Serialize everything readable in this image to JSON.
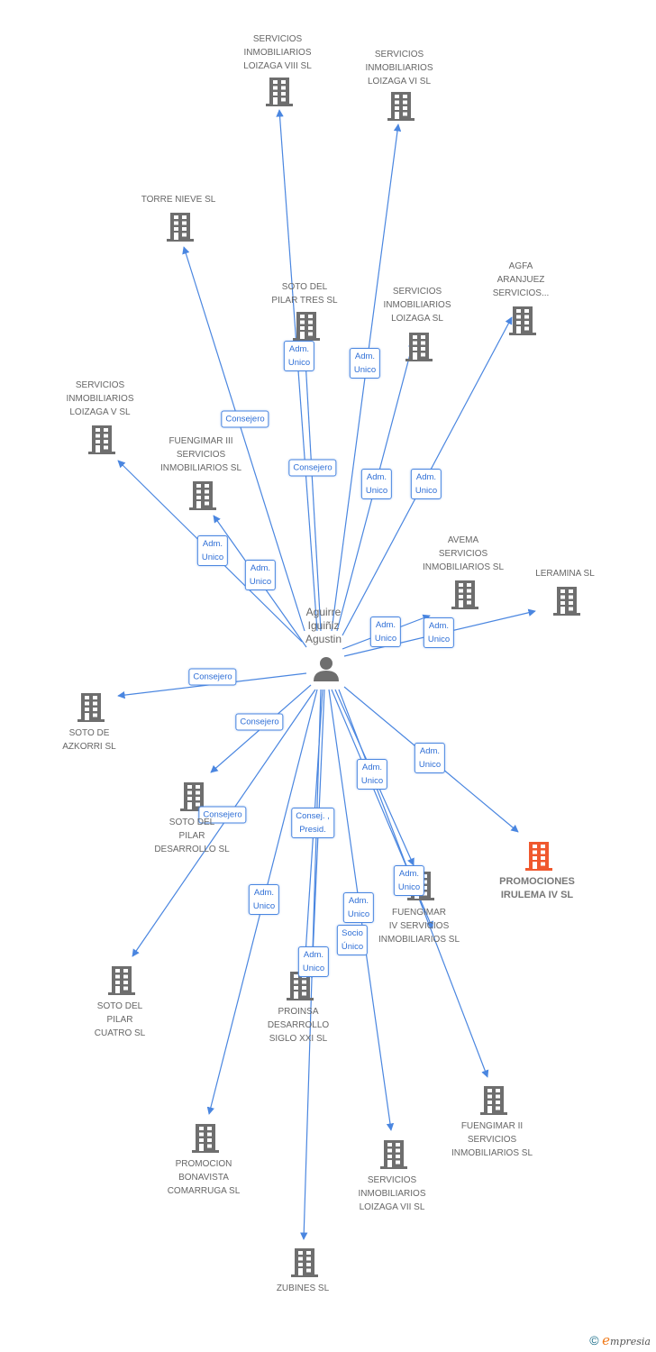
{
  "colors": {
    "edge": "#4a86e0",
    "node": "#6e6e6e",
    "highlight": "#f0582e",
    "text": "#666666"
  },
  "center": {
    "name": "Aguirre\nIguiñiz\nAgustin",
    "icon": "person-icon"
  },
  "nodes": [
    {
      "name": "SERVICIOS\nINMOBILIARIOS\nLOIZAGA VIII SL"
    },
    {
      "name": "SERVICIOS\nINMOBILIARIOS\nLOIZAGA VI SL"
    },
    {
      "name": "TORRE NIEVE SL"
    },
    {
      "name": "SOTO DEL\nPILAR TRES SL"
    },
    {
      "name": "SERVICIOS\nINMOBILIARIOS\nLOIZAGA SL"
    },
    {
      "name": "AGFA\nARANJUEZ\nSERVICIOS..."
    },
    {
      "name": "SERVICIOS\nINMOBILIARIOS\nLOIZAGA V SL"
    },
    {
      "name": "FUENGIMAR III\nSERVICIOS\nINMOBILIARIOS SL"
    },
    {
      "name": "AVEMA\nSERVICIOS\nINMOBILIARIOS SL"
    },
    {
      "name": "LERAMINA SL"
    },
    {
      "name": "SOTO DE\nAZKORRI SL"
    },
    {
      "name": "SOTO DEL\nPILAR\nDESARROLLO SL"
    },
    {
      "name": "PROMOCIONES\nIRULEMA IV SL",
      "highlight": true
    },
    {
      "name": "FUENGIMAR\nIV SERVICIOS\nINMOBILIARIOS SL"
    },
    {
      "name": "SOTO DEL\nPILAR\nCUATRO SL"
    },
    {
      "name": "PROINSA\nDESARROLLO\nSIGLO XXI SL"
    },
    {
      "name": "FUENGIMAR II\nSERVICIOS\nINMOBILIARIOS SL"
    },
    {
      "name": "PROMOCION\nBONAVISTA\nCOMARRUGA SL"
    },
    {
      "name": "SERVICIOS\nINMOBILIARIOS\nLOIZAGA VII SL"
    },
    {
      "name": "ZUBINES SL"
    }
  ],
  "edges": [
    {
      "to": 0,
      "label": "Adm.\nUnico"
    },
    {
      "to": 1,
      "label": "Adm.\nUnico"
    },
    {
      "to": 2,
      "label": "Consejero"
    },
    {
      "to": 3,
      "label": "Consejero"
    },
    {
      "to": 4,
      "label": "Adm.\nUnico"
    },
    {
      "to": 5,
      "label": "Adm.\nUnico"
    },
    {
      "to": 6,
      "label": "Adm.\nUnico"
    },
    {
      "to": 7,
      "label": "Adm.\nUnico"
    },
    {
      "to": 8,
      "label": "Adm.\nUnico"
    },
    {
      "to": 9,
      "label": "Adm.\nUnico"
    },
    {
      "to": 10,
      "label": "Consejero"
    },
    {
      "to": 11,
      "label": "Consejero"
    },
    {
      "to": 12,
      "label": "Adm.\nUnico"
    },
    {
      "to": 13,
      "label": "Adm.\nUnico"
    },
    {
      "to": 16,
      "label": "Adm.\nUnico"
    },
    {
      "to": 14,
      "label": "Consejero"
    },
    {
      "to": 15,
      "label": "Consej. ,\nPresid."
    },
    {
      "to": 15,
      "label": "Adm.\nUnico"
    },
    {
      "to": 17,
      "label": "Adm.\nUnico"
    },
    {
      "to": 18,
      "label": "Adm.\nUnico"
    },
    {
      "to": 13,
      "label": "Socio\nÚnico"
    },
    {
      "to": 19,
      "label": ""
    }
  ],
  "footer": {
    "copyright": "©",
    "brand_initial": "e",
    "brand_rest": "mpresia"
  }
}
